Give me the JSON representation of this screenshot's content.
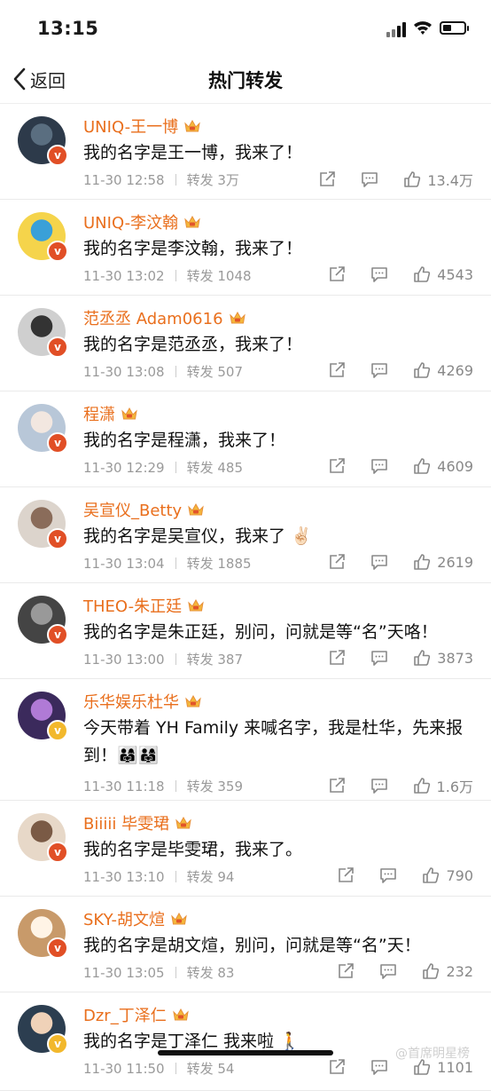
{
  "status": {
    "time": "13:15"
  },
  "nav": {
    "back_label": "返回",
    "title": "热门转发"
  },
  "repost_label": "转发",
  "items": [
    {
      "name": "UNIQ-王一博",
      "text": "我的名字是王一博，我来了！",
      "time": "11-30 12:58",
      "reposts": "3万",
      "likes": "13.4万",
      "badge": "red"
    },
    {
      "name": "UNIQ-李汶翰",
      "text": "我的名字是李汶翰，我来了！",
      "time": "11-30 13:02",
      "reposts": "1048",
      "likes": "4543",
      "badge": "red"
    },
    {
      "name": "范丞丞 Adam0616",
      "text": "我的名字是范丞丞，我来了！",
      "time": "11-30 13:08",
      "reposts": "507",
      "likes": "4269",
      "badge": "red"
    },
    {
      "name": "程潇",
      "text": "我的名字是程潇，我来了！",
      "time": "11-30 12:29",
      "reposts": "485",
      "likes": "4609",
      "badge": "red"
    },
    {
      "name": "吴宣仪_Betty",
      "text": "我的名字是吴宣仪，我来了 ✌🏻",
      "time": "11-30 13:04",
      "reposts": "1885",
      "likes": "2619",
      "badge": "red"
    },
    {
      "name": "THEO-朱正廷",
      "text": "我的名字是朱正廷，别问，问就是等“名”天咯！",
      "time": "11-30 13:00",
      "reposts": "387",
      "likes": "3873",
      "badge": "red"
    },
    {
      "name": "乐华娱乐杜华",
      "text": "今天带着 YH Family 来喊名字，我是杜华，先来报到！👨‍👩‍👧👨‍👩‍👧",
      "time": "11-30 11:18",
      "reposts": "359",
      "likes": "1.6万",
      "badge": "gold"
    },
    {
      "name": "Biiiii 毕雯珺",
      "text": "我的名字是毕雯珺，我来了。",
      "time": "11-30 13:10",
      "reposts": "94",
      "likes": "790",
      "badge": "red"
    },
    {
      "name": "SKY-胡文煊",
      "text": "我的名字是胡文煊，别问，问就是等“名”天！",
      "time": "11-30 13:05",
      "reposts": "83",
      "likes": "232",
      "badge": "red"
    },
    {
      "name": "Dzr_丁泽仁",
      "text": "我的名字是丁泽仁 我来啦 🚶",
      "time": "11-30 11:50",
      "reposts": "54",
      "likes": "1101",
      "badge": "gold"
    }
  ],
  "watermark": "@首席明星榜"
}
